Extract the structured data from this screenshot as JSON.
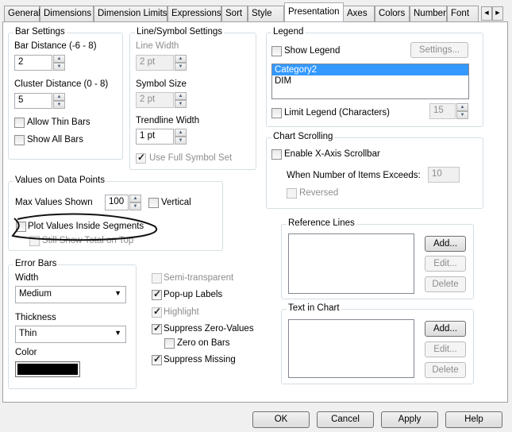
{
  "tabs": [
    "General",
    "Dimensions",
    "Dimension Limits",
    "Expressions",
    "Sort",
    "Style",
    "Presentation",
    "Axes",
    "Colors",
    "Number",
    "Font"
  ],
  "active_tab": "Presentation",
  "bar_settings": {
    "title": "Bar Settings",
    "bar_distance_label": "Bar Distance (-6 - 8)",
    "bar_distance": "2",
    "cluster_distance_label": "Cluster Distance (0 - 8)",
    "cluster_distance": "5",
    "allow_thin_bars": "Allow Thin Bars",
    "show_all_bars": "Show All Bars"
  },
  "line_symbol": {
    "title": "Line/Symbol Settings",
    "line_width_label": "Line Width",
    "line_width": "2 pt",
    "symbol_size_label": "Symbol Size",
    "symbol_size": "2 pt",
    "trendline_width_label": "Trendline Width",
    "trendline_width": "1 pt",
    "use_full_symbol_set": "Use Full Symbol Set"
  },
  "legend": {
    "title": "Legend",
    "show_legend": "Show Legend",
    "settings": "Settings...",
    "items": [
      "Category2",
      "DIM"
    ],
    "limit_legend": "Limit Legend (Characters)",
    "limit_value": "15"
  },
  "chart_scrolling": {
    "title": "Chart Scrolling",
    "enable": "Enable X-Axis Scrollbar",
    "exceeds_label": "When Number of Items Exceeds:",
    "exceeds_value": "10",
    "reversed": "Reversed"
  },
  "values_on_data_points": {
    "title": "Values on Data Points",
    "max_label": "Max Values Shown",
    "max_value": "100",
    "vertical": "Vertical",
    "plot_inside": "Plot Values Inside Segments",
    "still_show_total": "Still Show Total on Top"
  },
  "error_bars": {
    "title": "Error Bars",
    "width_label": "Width",
    "width_value": "Medium",
    "thickness_label": "Thickness",
    "thickness_value": "Thin",
    "color_label": "Color",
    "color": "#000000"
  },
  "options": {
    "semi_transparent": "Semi-transparent",
    "popup_labels": "Pop-up Labels",
    "highlight": "Highlight",
    "suppress_zero": "Suppress Zero-Values",
    "zero_on_bars": "Zero on Bars",
    "suppress_missing": "Suppress Missing"
  },
  "reference_lines": {
    "title": "Reference Lines",
    "add": "Add...",
    "edit": "Edit...",
    "delete": "Delete"
  },
  "text_in_chart": {
    "title": "Text in Chart",
    "add": "Add...",
    "edit": "Edit...",
    "delete": "Delete"
  },
  "footer": {
    "ok": "OK",
    "cancel": "Cancel",
    "apply": "Apply",
    "help": "Help"
  }
}
